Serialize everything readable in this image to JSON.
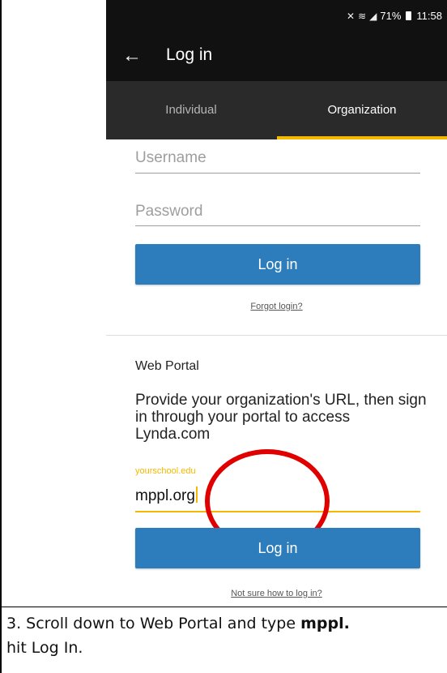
{
  "status_bar": {
    "battery": "71%",
    "time": "11:58",
    "icons": [
      "mute-icon",
      "wifi-icon",
      "4g-signal-icon",
      "battery-icon"
    ]
  },
  "app_bar": {
    "back_icon": "back-arrow-icon",
    "title": "Log in"
  },
  "tabs": {
    "individual": "Individual",
    "organization": "Organization",
    "active": "Organization"
  },
  "login_form": {
    "username_placeholder": "Username",
    "password_placeholder": "Password",
    "login_button": "Log in",
    "forgot_link": "Forgot login?"
  },
  "web_portal": {
    "title": "Web Portal",
    "description": "Provide your organization's URL, then sign in through your portal to access Lynda.com",
    "url_label": "yourschool.edu",
    "url_value": "mppl.org",
    "login_button": "Log in",
    "help_link": "Not sure how to log in?"
  },
  "colors": {
    "accent": "#f5b800",
    "button": "#2d7dbd",
    "annotation": "#e10000"
  },
  "caption": {
    "prefix": "3. Scroll down to Web Portal and type ",
    "bold": "mppl.",
    "line2": "hit Log In."
  }
}
